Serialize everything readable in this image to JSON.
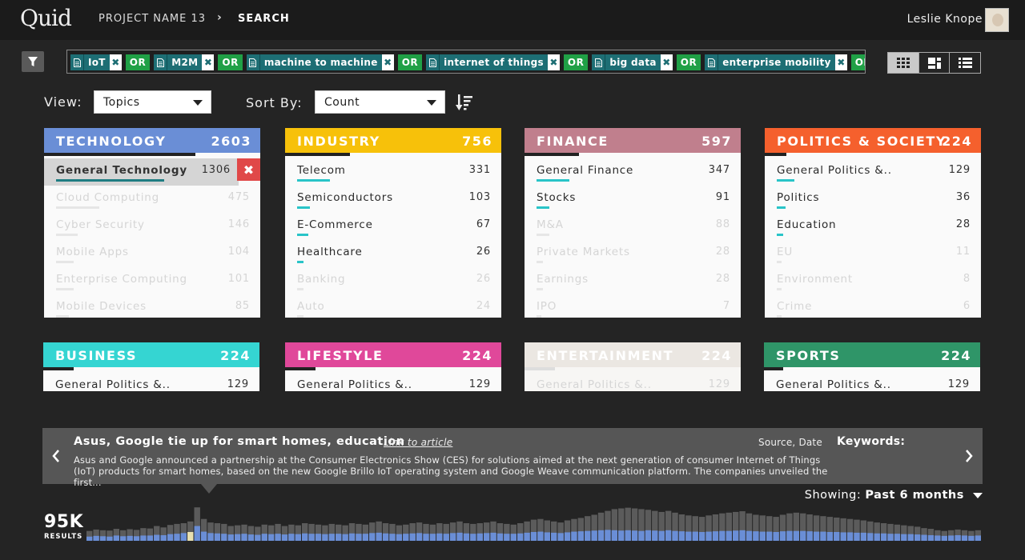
{
  "app": {
    "logo": "Quid"
  },
  "breadcrumb": {
    "project": "PROJECT NAME 13",
    "separator": "›",
    "current": "SEARCH"
  },
  "user": {
    "name": "Leslie Knope"
  },
  "query": {
    "tags": [
      "IoT",
      "M2M",
      "machine to machine",
      "internet of things",
      "big data",
      "enterprise mobility"
    ],
    "operator": "OR",
    "remove_glyph": "✖"
  },
  "view_modes": {
    "icons": [
      "grid-view-icon",
      "mosaic-view-icon",
      "list-view-icon"
    ],
    "active": "grid"
  },
  "controls": {
    "view_label": "View:",
    "view_value": "Topics",
    "sort_label": "Sort By:",
    "sort_value": "Count"
  },
  "categories": [
    {
      "title": "TECHNOLOGY",
      "count": "2603",
      "color": "#6a8ed6",
      "progress": 0.7,
      "rows": [
        {
          "label": "General Technology",
          "count": "1306",
          "bar": 0.5,
          "state": "selected"
        },
        {
          "label": "Cloud Computing",
          "count": "475",
          "bar": 0.2,
          "state": "faded"
        },
        {
          "label": "Cyber Security",
          "count": "146",
          "bar": 0.1,
          "state": "faded"
        },
        {
          "label": "Mobile Apps",
          "count": "104",
          "bar": 0.08,
          "state": "faded"
        },
        {
          "label": "Enterprise Computing",
          "count": "101",
          "bar": 0.08,
          "state": "faded"
        },
        {
          "label": "Mobile Devices",
          "count": "85",
          "bar": 0.06,
          "state": "faded"
        }
      ]
    },
    {
      "title": "INDUSTRY",
      "count": "756",
      "color": "#f7c10a",
      "progress": 0.3,
      "rows": [
        {
          "label": "Telecom",
          "count": "331",
          "bar": 0.15,
          "state": "normal"
        },
        {
          "label": "Semiconductors",
          "count": "103",
          "bar": 0.06,
          "state": "normal"
        },
        {
          "label": "E-Commerce",
          "count": "67",
          "bar": 0.05,
          "state": "normal"
        },
        {
          "label": "Healthcare",
          "count": "26",
          "bar": 0.03,
          "state": "normal"
        },
        {
          "label": "Banking",
          "count": "26",
          "bar": 0.03,
          "state": "faded"
        },
        {
          "label": "Auto",
          "count": "24",
          "bar": 0.03,
          "state": "faded"
        }
      ]
    },
    {
      "title": "FINANCE",
      "count": "597",
      "color": "#c07f8d",
      "progress": 0.25,
      "rows": [
        {
          "label": "General Finance",
          "count": "347",
          "bar": 0.15,
          "state": "normal"
        },
        {
          "label": "Stocks",
          "count": "91",
          "bar": 0.06,
          "state": "normal"
        },
        {
          "label": "M&A",
          "count": "88",
          "bar": 0.06,
          "state": "faded"
        },
        {
          "label": "Private Markets",
          "count": "28",
          "bar": 0.03,
          "state": "faded"
        },
        {
          "label": "Earnings",
          "count": "28",
          "bar": 0.03,
          "state": "faded"
        },
        {
          "label": "IPO",
          "count": "7",
          "bar": 0.02,
          "state": "faded"
        }
      ]
    },
    {
      "title": "POLITICS & SOCIETY",
      "count": "224",
      "color": "#f5602d",
      "progress": 0.1,
      "rows": [
        {
          "label": "General Politics &..",
          "count": "129",
          "bar": 0.08,
          "state": "normal"
        },
        {
          "label": "Politics",
          "count": "36",
          "bar": 0.04,
          "state": "normal"
        },
        {
          "label": "Education",
          "count": "28",
          "bar": 0.03,
          "state": "normal"
        },
        {
          "label": "EU",
          "count": "11",
          "bar": 0.02,
          "state": "faded"
        },
        {
          "label": "Environment",
          "count": "8",
          "bar": 0.02,
          "state": "faded"
        },
        {
          "label": "Crime",
          "count": "6",
          "bar": 0.02,
          "state": "faded"
        }
      ]
    },
    {
      "title": "BUSINESS",
      "count": "224",
      "color": "#35d5d2",
      "progress": 0.14,
      "rows": [
        {
          "label": "General Politics &..",
          "count": "129",
          "bar": 0.08,
          "state": "normal"
        }
      ]
    },
    {
      "title": "LIFESTYLE",
      "count": "224",
      "color": "#e0489a",
      "progress": 0.14,
      "rows": [
        {
          "label": "General Politics &..",
          "count": "129",
          "bar": 0.08,
          "state": "normal"
        }
      ]
    },
    {
      "title": "ENTERTAINMENT",
      "count": "224",
      "color": "#ebe7e2",
      "progress": 0.14,
      "dimmed": true,
      "rows": [
        {
          "label": "General Politics &..",
          "count": "129",
          "bar": 0.08,
          "state": "faded"
        }
      ]
    },
    {
      "title": "SPORTS",
      "count": "224",
      "color": "#2f9568",
      "progress": 0.09,
      "rows": [
        {
          "label": "General Politics &..",
          "count": "129",
          "bar": 0.08,
          "state": "normal"
        }
      ]
    }
  ],
  "article": {
    "title": "Asus, Google tie up for smart homes, education",
    "link": "Link to article",
    "source": "Source, Date",
    "keywords_label": "Keywords:",
    "body": "Asus and Google announced a partnership at the Consumer Electronics Show (CES) for solutions aimed at the next generation of consumer Internet of Things (IoT) products for smart homes, based on the new Google Brillo IoT operating system and Google Weave communication platform. The companies unveiled the first..."
  },
  "showing": {
    "label": "Showing:",
    "value": "Past 6 months"
  },
  "results": {
    "count": "95K",
    "label": "RESULTS"
  },
  "histogram": {
    "highlight_index": 15,
    "bars_total": [
      0.28,
      0.32,
      0.3,
      0.29,
      0.34,
      0.3,
      0.33,
      0.31,
      0.36,
      0.35,
      0.42,
      0.38,
      0.45,
      0.48,
      0.5,
      0.55,
      0.95,
      0.62,
      0.52,
      0.5,
      0.48,
      0.42,
      0.44,
      0.46,
      0.42,
      0.4,
      0.46,
      0.44,
      0.48,
      0.42,
      0.46,
      0.44,
      0.5,
      0.48,
      0.46,
      0.44,
      0.48,
      0.46,
      0.44,
      0.5,
      0.48,
      0.46,
      0.52,
      0.55,
      0.5,
      0.48,
      0.44,
      0.46,
      0.5,
      0.52,
      0.48,
      0.46,
      0.5,
      0.48,
      0.52,
      0.55,
      0.5,
      0.48,
      0.5,
      0.52,
      0.55,
      0.5,
      0.48,
      0.46,
      0.5,
      0.55,
      0.6,
      0.62,
      0.58,
      0.55,
      0.52,
      0.58,
      0.62,
      0.65,
      0.7,
      0.74,
      0.8,
      0.85,
      0.9,
      0.92,
      0.94,
      0.92,
      0.9,
      0.88,
      0.85,
      0.82,
      0.85,
      0.8,
      0.75,
      0.72,
      0.7,
      0.68,
      0.72,
      0.75,
      0.78,
      0.8,
      0.82,
      0.84,
      0.78,
      0.74,
      0.72,
      0.7,
      0.68,
      0.74,
      0.78,
      0.8,
      0.78,
      0.75,
      0.72,
      0.7,
      0.68,
      0.66,
      0.64,
      0.62,
      0.6,
      0.58,
      0.55,
      0.52,
      0.5,
      0.48,
      0.46,
      0.44,
      0.42,
      0.4,
      0.36,
      0.34,
      0.3,
      0.28,
      0.3,
      0.32,
      0.3,
      0.28,
      0.3
    ],
    "bars_part": [
      0.12,
      0.14,
      0.13,
      0.12,
      0.15,
      0.13,
      0.14,
      0.13,
      0.15,
      0.15,
      0.17,
      0.16,
      0.19,
      0.2,
      0.22,
      0.25,
      0.42,
      0.26,
      0.22,
      0.21,
      0.2,
      0.18,
      0.19,
      0.2,
      0.18,
      0.17,
      0.2,
      0.19,
      0.2,
      0.18,
      0.2,
      0.19,
      0.21,
      0.2,
      0.2,
      0.19,
      0.2,
      0.2,
      0.19,
      0.21,
      0.2,
      0.2,
      0.22,
      0.23,
      0.21,
      0.2,
      0.19,
      0.2,
      0.21,
      0.22,
      0.2,
      0.2,
      0.21,
      0.2,
      0.22,
      0.23,
      0.21,
      0.2,
      0.21,
      0.22,
      0.23,
      0.21,
      0.2,
      0.2,
      0.21,
      0.23,
      0.25,
      0.26,
      0.24,
      0.23,
      0.22,
      0.24,
      0.26,
      0.27,
      0.28,
      0.29,
      0.3,
      0.31,
      0.3,
      0.29,
      0.3,
      0.29,
      0.28,
      0.3,
      0.29,
      0.28,
      0.3,
      0.28,
      0.27,
      0.26,
      0.26,
      0.25,
      0.26,
      0.27,
      0.28,
      0.28,
      0.29,
      0.3,
      0.28,
      0.27,
      0.26,
      0.26,
      0.25,
      0.27,
      0.28,
      0.28,
      0.28,
      0.27,
      0.26,
      0.26,
      0.25,
      0.25,
      0.24,
      0.24,
      0.23,
      0.23,
      0.22,
      0.21,
      0.21,
      0.2,
      0.2,
      0.19,
      0.19,
      0.18,
      0.17,
      0.16,
      0.15,
      0.14,
      0.15,
      0.16,
      0.15,
      0.14,
      0.15
    ],
    "colors": {
      "total": "#5b5b5b",
      "part": "#6a8ed6",
      "highlight": "#e8e0b0"
    }
  }
}
